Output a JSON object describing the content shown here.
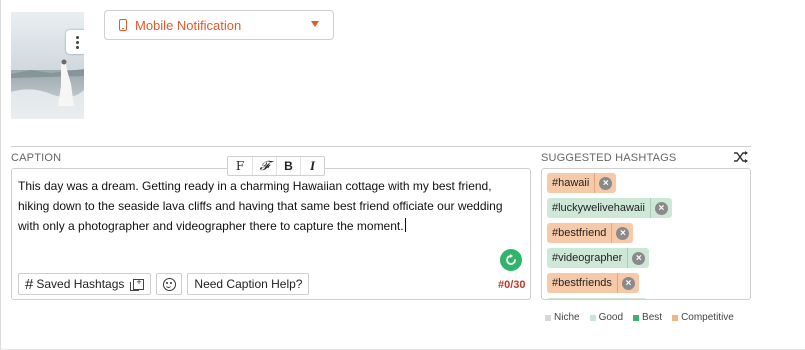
{
  "platform": {
    "label": "Mobile Notification",
    "icon": "phone-icon",
    "accent_color": "#e05a2b"
  },
  "caption": {
    "heading": "CAPTION",
    "text": "This day was a dream. Getting ready in a charming Hawaiian cottage with my best friend, hiking down to the seaside lava cliffs and having that same best friend officiate our wedding with only a photographer and videographer there to capture the moment.",
    "format_buttons": [
      "F",
      "𝓕",
      "B",
      "I"
    ],
    "saved_hashtags_label": "Saved Hashtags",
    "caption_help_label": "Need Caption Help?",
    "counter": "#0/30"
  },
  "hashtags": {
    "heading": "SUGGESTED HASHTAGS",
    "items": [
      {
        "tag": "#hawaii",
        "level": "competitive"
      },
      {
        "tag": "#luckywelivehawaii",
        "level": "good"
      },
      {
        "tag": "#bestfriend",
        "level": "competitive"
      },
      {
        "tag": "#videographer",
        "level": "good"
      },
      {
        "tag": "#bestfriends",
        "level": "competitive"
      }
    ]
  },
  "legend": [
    {
      "label": "Niche",
      "color": "#d8d8d8"
    },
    {
      "label": "Good",
      "color": "#c8e6d2"
    },
    {
      "label": "Best",
      "color": "#3cb371"
    },
    {
      "label": "Competitive",
      "color": "#f2b48a"
    }
  ]
}
